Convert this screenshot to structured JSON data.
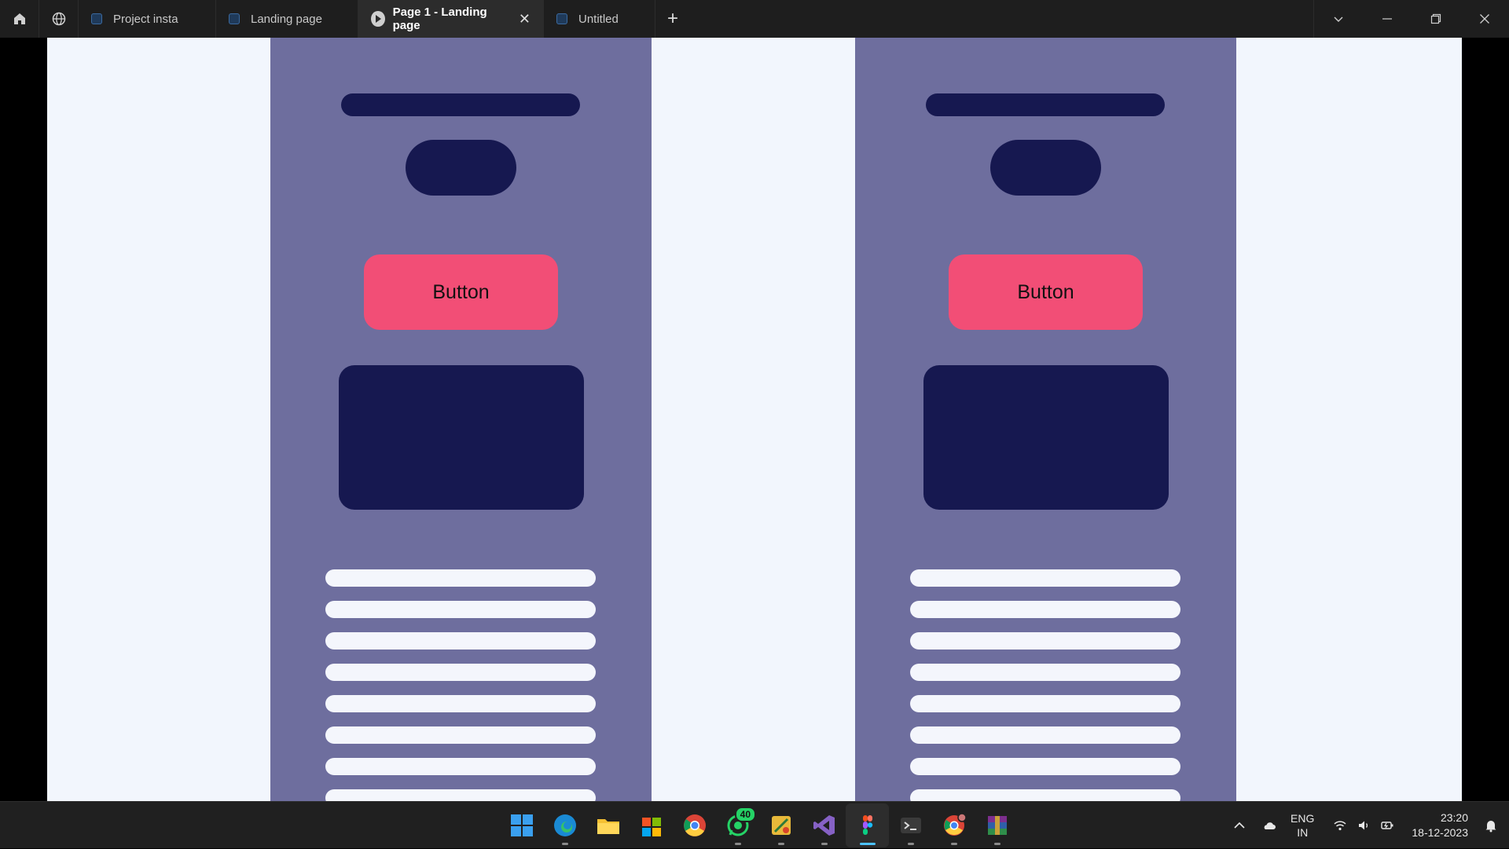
{
  "titlebar": {
    "tabs": [
      {
        "label": "Project insta",
        "icon": "figma-file-icon",
        "active": false
      },
      {
        "label": "Landing page",
        "icon": "figma-file-icon",
        "active": false
      },
      {
        "label": "Page 1 - Landing page",
        "icon": "play-icon",
        "active": true
      },
      {
        "label": "Untitled",
        "icon": "figma-file-icon",
        "active": false
      }
    ],
    "add_tab_icon": "plus-icon",
    "left_icons": [
      "home-icon",
      "globe-icon"
    ],
    "window_controls": [
      "chevron-down-icon",
      "minimize-icon",
      "restore-icon",
      "close-icon"
    ]
  },
  "canvas": {
    "background": "#f2f6fd",
    "frames": [
      {
        "button_label": "Button",
        "text_line_count": 8
      },
      {
        "button_label": "Button",
        "text_line_count": 8
      }
    ],
    "colors": {
      "frame": "#6e6e9e",
      "dark_block": "#161850",
      "button": "#f24e76",
      "text_line": "#f4f6fc"
    }
  },
  "taskbar": {
    "apps": [
      {
        "name": "start-icon"
      },
      {
        "name": "edge-icon"
      },
      {
        "name": "file-explorer-icon"
      },
      {
        "name": "microsoft-store-icon"
      },
      {
        "name": "chrome-icon"
      },
      {
        "name": "whatsapp-icon",
        "badge": "40"
      },
      {
        "name": "drawing-app-icon"
      },
      {
        "name": "visual-studio-icon"
      },
      {
        "name": "figma-icon",
        "active": true
      },
      {
        "name": "terminal-icon"
      },
      {
        "name": "chrome-profile-icon"
      },
      {
        "name": "winrar-icon"
      }
    ],
    "tray": {
      "language_line1": "ENG",
      "language_line2": "IN",
      "time": "23:20",
      "date": "18-12-2023"
    }
  }
}
